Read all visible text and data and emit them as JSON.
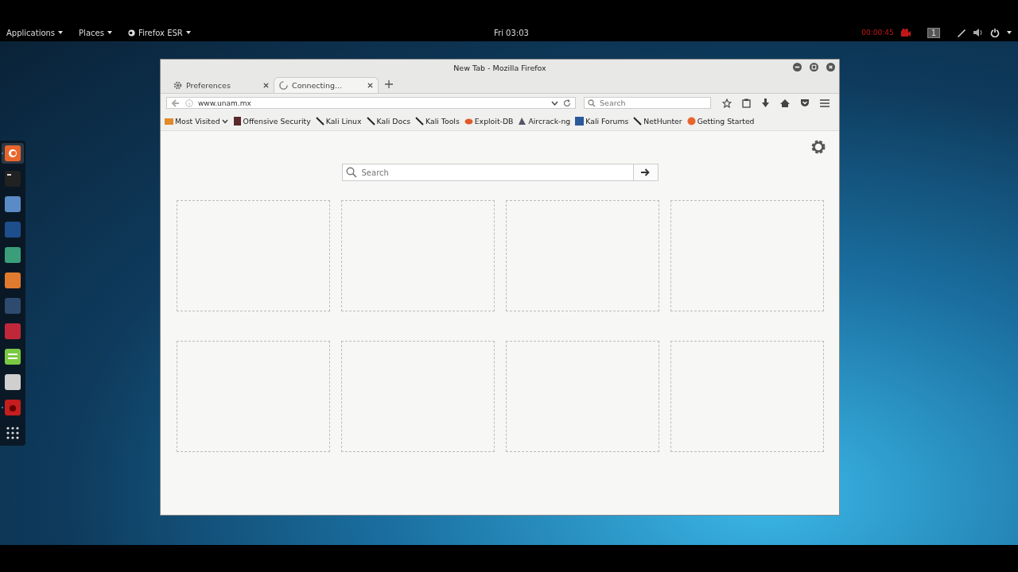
{
  "top_panel": {
    "menus": [
      {
        "label": "Applications",
        "kind": "plain"
      },
      {
        "label": "Places",
        "kind": "plain"
      },
      {
        "label": "Firefox ESR",
        "kind": "app"
      }
    ],
    "clock": "Fri 03:03",
    "recording_time": "00:00:45",
    "workspace": "1"
  },
  "dock": [
    {
      "kind": "firefox",
      "active": true,
      "running": true
    },
    {
      "kind": "terminal",
      "active": false,
      "running": false
    },
    {
      "kind": "files",
      "active": false,
      "running": false
    },
    {
      "kind": "metasploit",
      "active": false,
      "running": false
    },
    {
      "kind": "armitage",
      "active": false,
      "running": false
    },
    {
      "kind": "burp",
      "active": false,
      "running": false
    },
    {
      "kind": "beef",
      "active": false,
      "running": false
    },
    {
      "kind": "faraday",
      "active": false,
      "running": false
    },
    {
      "kind": "leafpad",
      "active": false,
      "running": false
    },
    {
      "kind": "settings",
      "active": false,
      "running": false
    },
    {
      "kind": "recorder",
      "active": false,
      "running": true
    },
    {
      "kind": "grid",
      "active": false,
      "running": false
    }
  ],
  "window": {
    "title": "New Tab - Mozilla Firefox",
    "tabs": [
      {
        "label": "Preferences",
        "kind": "gear",
        "selected": false
      },
      {
        "label": "Connecting...",
        "kind": "loading",
        "selected": true
      }
    ],
    "url": "www.unam.mx",
    "search": {
      "placeholder": "Search"
    },
    "bookmarks": [
      {
        "label": "Most Visited",
        "kind": "folder"
      },
      {
        "label": "Offensive Security",
        "kind": "offsec"
      },
      {
        "label": "Kali Linux",
        "kind": "kali"
      },
      {
        "label": "Kali Docs",
        "kind": "kali"
      },
      {
        "label": "Kali Tools",
        "kind": "kali"
      },
      {
        "label": "Exploit-DB",
        "kind": "exploit"
      },
      {
        "label": "Aircrack-ng",
        "kind": "aircrack"
      },
      {
        "label": "Kali Forums",
        "kind": "forums"
      },
      {
        "label": "NetHunter",
        "kind": "kali"
      },
      {
        "label": "Getting Started",
        "kind": "firefox"
      }
    ],
    "page_search": {
      "placeholder": "Search"
    }
  }
}
